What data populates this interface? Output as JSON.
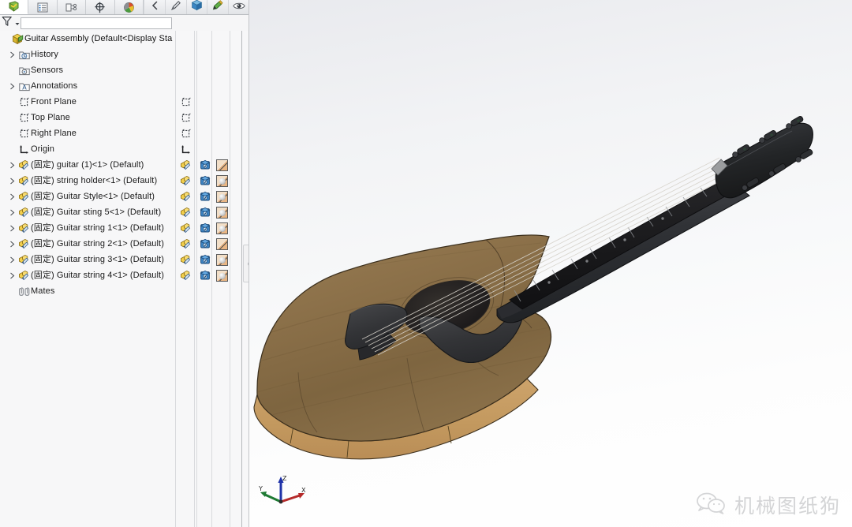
{
  "app": {
    "title": "SolidWorks — Guitar Assembly",
    "background_color": "#f7f7f8",
    "viewport_gradient_top": "#e9eaee",
    "viewport_gradient_bottom": "#ffffff"
  },
  "tabs": [
    {
      "name": "feature-manager-tree",
      "icon": "feature-tree-icon",
      "title": "FeatureManager design tree",
      "active": true
    },
    {
      "name": "property-manager",
      "icon": "property-manager-icon",
      "title": "PropertyManager",
      "active": false
    },
    {
      "name": "configuration-manager",
      "icon": "configuration-manager-icon",
      "title": "ConfigurationManager",
      "active": false
    },
    {
      "name": "dimxpert-manager",
      "icon": "dimxpert-icon",
      "title": "DimXpertManager",
      "active": false
    },
    {
      "name": "display-manager",
      "icon": "display-manager-icon",
      "title": "DisplayManager",
      "active": false
    }
  ],
  "tab_tools": [
    {
      "name": "collapse-flyout",
      "icon": "chevron-left-icon"
    },
    {
      "name": "edit-appearance",
      "icon": "pencil-icon"
    },
    {
      "name": "appearance-cube",
      "icon": "cube-icon"
    },
    {
      "name": "edit-color",
      "icon": "color-pencil-icon"
    },
    {
      "name": "hide-show",
      "icon": "eye-icon"
    }
  ],
  "filter": {
    "icon": "funnel-icon",
    "dropdown_icon": "chevron-down-icon",
    "value": "",
    "placeholder": ""
  },
  "tree": {
    "root": {
      "label": "Guitar Assembly  (Default<Display Sta",
      "icon": "assembly-icon",
      "has_children": false
    },
    "items": [
      {
        "label": "History",
        "icon": "history-folder-icon",
        "indent": 1,
        "expandable": true,
        "side_icons": []
      },
      {
        "label": "Sensors",
        "icon": "sensors-folder-icon",
        "indent": 1,
        "expandable": false,
        "side_icons": []
      },
      {
        "label": "Annotations",
        "icon": "annotations-folder-icon",
        "indent": 1,
        "expandable": true,
        "side_icons": []
      },
      {
        "label": "Front Plane",
        "icon": "plane-icon",
        "indent": 1,
        "expandable": false,
        "side_icons": [
          "plane-icon"
        ]
      },
      {
        "label": "Top Plane",
        "icon": "plane-icon",
        "indent": 1,
        "expandable": false,
        "side_icons": [
          "plane-icon"
        ]
      },
      {
        "label": "Right Plane",
        "icon": "plane-icon",
        "indent": 1,
        "expandable": false,
        "side_icons": [
          "plane-icon"
        ]
      },
      {
        "label": "Origin",
        "icon": "origin-icon",
        "indent": 1,
        "expandable": false,
        "side_icons": [
          "origin-icon"
        ]
      },
      {
        "label": "(固定) guitar (1)<1>  (Default)",
        "icon": "component-icon",
        "indent": 1,
        "expandable": true,
        "side_icons": [
          "component-icon",
          "config-cube-icon",
          "appearance-swatch-plain"
        ]
      },
      {
        "label": "(固定) string holder<1>  (Default)",
        "icon": "component-icon",
        "indent": 1,
        "expandable": true,
        "side_icons": [
          "component-icon",
          "config-cube-icon",
          "appearance-swatch-ball"
        ]
      },
      {
        "label": "(固定) Guitar Style<1>  (Default)",
        "icon": "component-icon",
        "indent": 1,
        "expandable": true,
        "side_icons": [
          "component-icon",
          "config-cube-icon",
          "appearance-swatch-ball"
        ]
      },
      {
        "label": "(固定) Guitar sting 5<1>  (Default)",
        "icon": "component-icon",
        "indent": 1,
        "expandable": true,
        "side_icons": [
          "component-icon",
          "config-cube-icon",
          "appearance-swatch-ball"
        ]
      },
      {
        "label": "(固定) Guitar string 1<1>  (Default)",
        "icon": "component-icon",
        "indent": 1,
        "expandable": true,
        "side_icons": [
          "component-icon",
          "config-cube-icon",
          "appearance-swatch-ball"
        ]
      },
      {
        "label": "(固定) Guitar string 2<1>  (Default)",
        "icon": "component-icon",
        "indent": 1,
        "expandable": true,
        "side_icons": [
          "component-icon",
          "config-cube-icon",
          "appearance-swatch-plain"
        ]
      },
      {
        "label": "(固定) Guitar string 3<1>  (Default)",
        "icon": "component-icon",
        "indent": 1,
        "expandable": true,
        "side_icons": [
          "component-icon",
          "config-cube-icon",
          "appearance-swatch-ball"
        ]
      },
      {
        "label": "(固定) Guitar string 4<1>  (Default)",
        "icon": "component-icon",
        "indent": 1,
        "expandable": true,
        "side_icons": [
          "component-icon",
          "config-cube-icon",
          "appearance-swatch-ball"
        ]
      },
      {
        "label": "Mates",
        "icon": "mates-icon",
        "indent": 1,
        "expandable": false,
        "side_icons": []
      }
    ]
  },
  "splitter": {
    "name": "panel-splitter",
    "handle_icon": "grip-dot-icon"
  },
  "model": {
    "name": "acoustic-guitar-assembly",
    "body_top_color": "#8a7049",
    "body_side_color": "#c59a63",
    "neck_color": "#2a2a2c",
    "fretboard_color": "#1b1b1d",
    "headstock_color": "#232325",
    "pickguard_color": "#3a3a3c",
    "soundhole_color": "#231f1c",
    "edge_color": "#4a3a24",
    "string_color": "#d8d4cc"
  },
  "triad": {
    "name": "view-orientation-triad",
    "axes": [
      {
        "label": "X",
        "color": "#b52a2a"
      },
      {
        "label": "Y",
        "color": "#1e7a33"
      },
      {
        "label": "Z",
        "color": "#1f32a8"
      }
    ]
  },
  "watermark": {
    "icon": "wechat-icon",
    "text": "机械图纸狗",
    "color": "#9a9ca0"
  }
}
